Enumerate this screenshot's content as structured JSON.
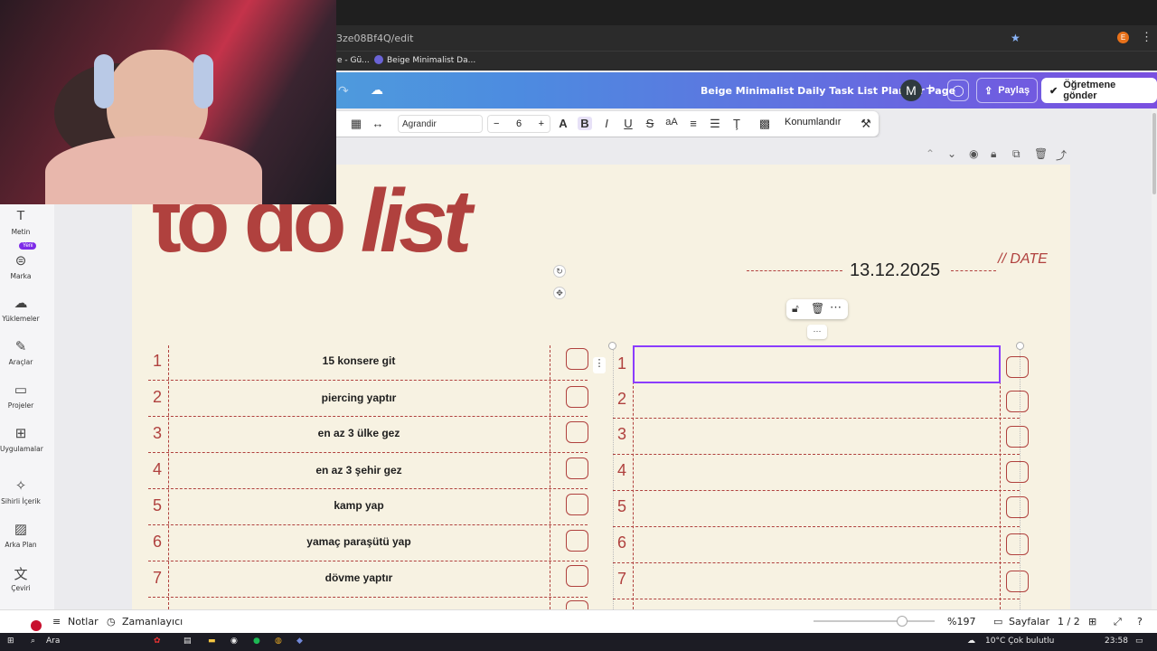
{
  "browser": {
    "url": "3ze08Bf4Q/edit",
    "bookmarks": [
      "e - Gü...",
      "Beige Minimalist Da..."
    ]
  },
  "header": {
    "doc_title": "Beige Minimalist Daily Task List Planner Page",
    "avatar_letter": "M",
    "share_label": "Paylaş",
    "send_label": "Öğretmene gönder"
  },
  "toolbar": {
    "font": "Agrandir",
    "font_size": "6",
    "position_label": "Konumlandır"
  },
  "sidebar": {
    "items": [
      {
        "label": "Metin",
        "icon": "text-icon"
      },
      {
        "label": "Marka",
        "icon": "brand-icon",
        "badge": "Yeni"
      },
      {
        "label": "Yüklemeler",
        "icon": "upload-icon"
      },
      {
        "label": "Araçlar",
        "icon": "draw-icon"
      },
      {
        "label": "Projeler",
        "icon": "folder-icon"
      },
      {
        "label": "Uygulamalar",
        "icon": "apps-icon"
      },
      {
        "label": "Sihirli İçerik",
        "icon": "magic-icon"
      },
      {
        "label": "Arka Plan",
        "icon": "background-icon"
      },
      {
        "label": "Çeviri",
        "icon": "translate-icon"
      }
    ]
  },
  "page": {
    "title_part1": "to do ",
    "title_part2": "list",
    "date_value": "13.12.2025",
    "date_label": "// DATE",
    "left_list": [
      {
        "num": "1",
        "task": "15 konsere git"
      },
      {
        "num": "2",
        "task": "piercing yaptır"
      },
      {
        "num": "3",
        "task": "en az 3 ülke gez"
      },
      {
        "num": "4",
        "task": "en az 3 şehir gez"
      },
      {
        "num": "5",
        "task": "kamp yap"
      },
      {
        "num": "6",
        "task": "yamaç paraşütü yap"
      },
      {
        "num": "7",
        "task": "dövme yaptır"
      }
    ],
    "right_list": [
      "1",
      "2",
      "3",
      "4",
      "5",
      "6",
      "7"
    ]
  },
  "bottombar": {
    "notes": "Notlar",
    "timer": "Zamanlayıcı",
    "zoom": "%197",
    "pages_label": "Sayfalar",
    "page_count": "1 / 2"
  },
  "taskbar": {
    "search": "Ara",
    "weather": "10°C  Çok bulutlu",
    "time": "23:58"
  },
  "colors": {
    "accent": "#b0413e",
    "page_bg": "#f7f2e2",
    "selection": "#8b3dff"
  }
}
